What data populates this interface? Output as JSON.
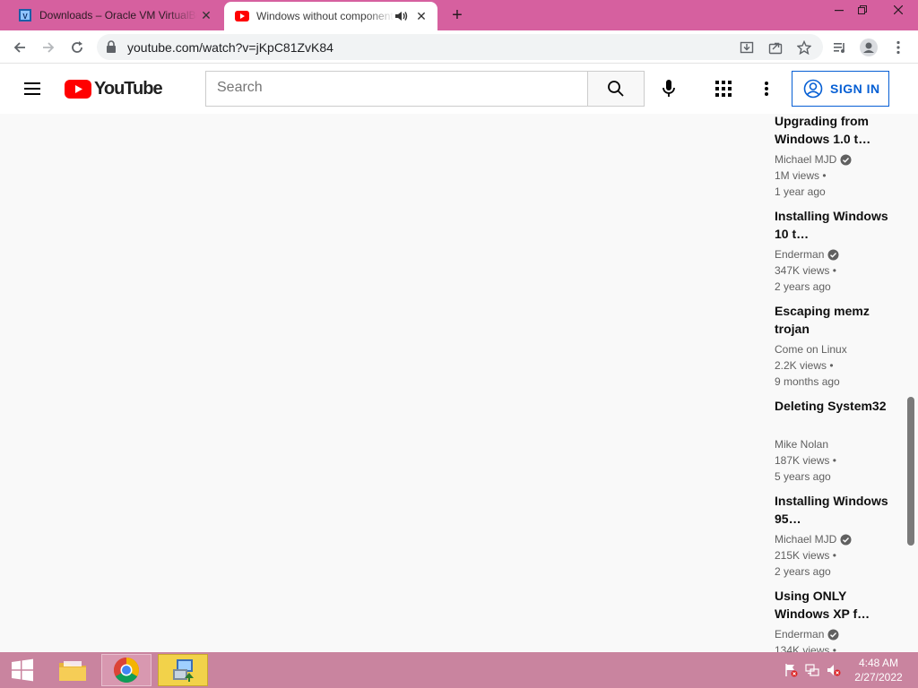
{
  "browser": {
    "tabs": [
      {
        "title": "Downloads – Oracle VM VirtualBox",
        "icon": "virtualbox-favicon",
        "active": false
      },
      {
        "title": "Windows without components",
        "icon": "youtube-favicon",
        "active": true,
        "audio": true
      }
    ],
    "new_tab_icon": "plus-icon",
    "url": "youtube.com/watch?v=jKpC81ZvK84",
    "window_controls": [
      "minimize",
      "restore",
      "close"
    ]
  },
  "youtube": {
    "logo_text": "YouTube",
    "search_placeholder": "Search",
    "sign_in_label": "SIGN IN",
    "brand_red": "#ff0000",
    "accent_blue": "#065fd4"
  },
  "recommendations": [
    {
      "title": "Upgrading from Windows 1.0 t…",
      "channel": "Michael MJD",
      "verified": true,
      "views": "1M views •",
      "age": "1 year ago"
    },
    {
      "title": "Installing Windows 10 t…",
      "channel": "Enderman",
      "verified": true,
      "views": "347K views •",
      "age": "2 years ago"
    },
    {
      "title": "Escaping memz trojan",
      "channel": "Come on Linux",
      "verified": false,
      "views": "2.2K views •",
      "age": "9 months ago"
    },
    {
      "title": "Deleting System32",
      "channel": "Mike Nolan",
      "verified": false,
      "views": "187K views •",
      "age": "5 years ago"
    },
    {
      "title": "Installing Windows 95…",
      "channel": "Michael MJD",
      "verified": true,
      "views": "215K views •",
      "age": "2 years ago"
    },
    {
      "title": "Using ONLY Windows XP f…",
      "channel": "Enderman",
      "verified": true,
      "views": "134K views •",
      "age": ""
    }
  ],
  "taskbar": {
    "apps": [
      "file-explorer",
      "chrome",
      "virtualbox-installer"
    ],
    "time": "4:48 AM",
    "date": "2/27/2022",
    "tray_icons": [
      "action-center-flag-icon",
      "network-icon",
      "volume-muted-icon"
    ]
  }
}
